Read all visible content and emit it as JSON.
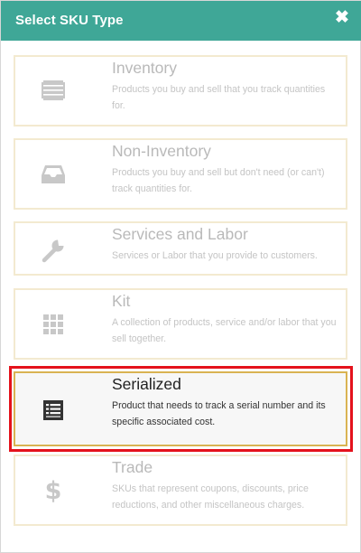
{
  "dialog": {
    "title": "Select SKU Type",
    "close_glyph": "✖"
  },
  "options": [
    {
      "title": "Inventory",
      "description": "Products you buy and sell that you track quantities for.",
      "icon": "barcode-icon",
      "selected": false
    },
    {
      "title": "Non-Inventory",
      "description": "Products you buy and sell but don't need (or can't) track quantities for.",
      "icon": "inbox-tray-icon",
      "selected": false
    },
    {
      "title": "Services and Labor",
      "description": "Services or Labor that you provide to customers.",
      "icon": "wrench-icon",
      "selected": false
    },
    {
      "title": "Kit",
      "description": "A collection of products, service and/or labor that you sell together.",
      "icon": "grid-icon",
      "selected": false
    },
    {
      "title": "Serialized",
      "description": "Product that needs to track a serial number and its specific associated cost.",
      "icon": "list-document-icon",
      "selected": true
    },
    {
      "title": "Trade",
      "description": "SKUs that represent coupons, discounts, price reductions, and other miscellaneous charges.",
      "icon": "dollar-icon",
      "selected": false
    }
  ],
  "colors": {
    "header": "#3fa797",
    "option_border": "#f3ead0",
    "selected_border": "#d9b352",
    "highlight_outline": "#e4121c",
    "disabled_icon": "#c8c8c8",
    "selected_icon": "#333333"
  }
}
